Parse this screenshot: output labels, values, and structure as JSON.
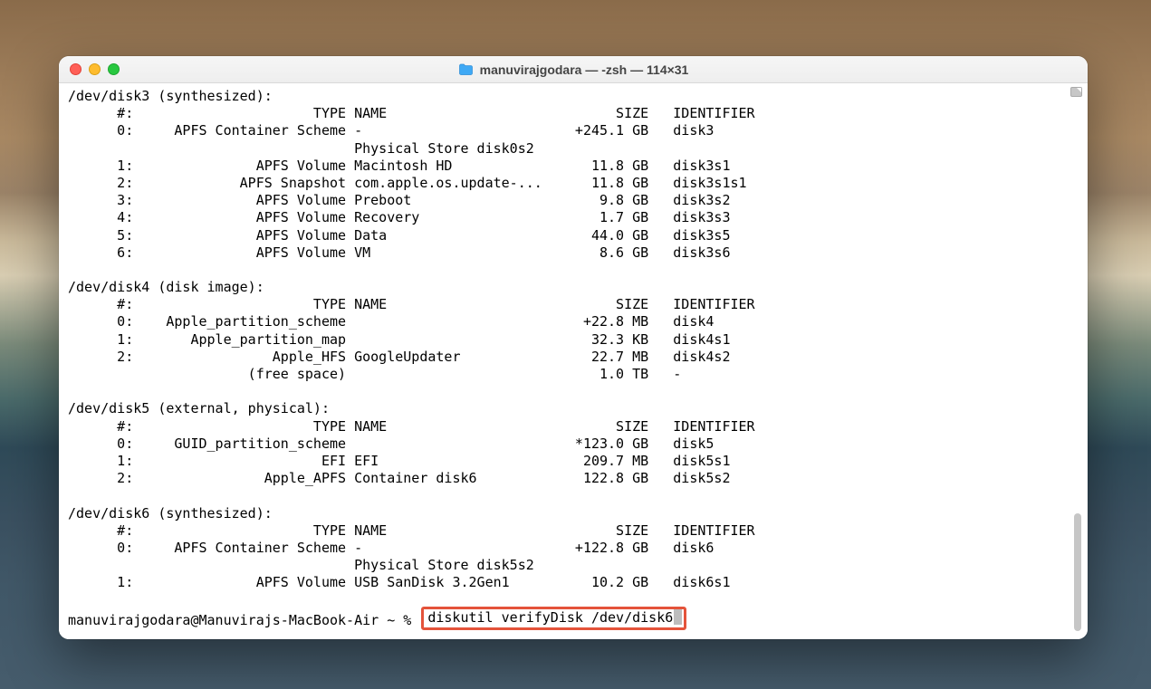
{
  "window": {
    "title": "manuvirajgodara — -zsh — 114×31"
  },
  "terminal": {
    "columns": {
      "num": 5,
      "type": 26,
      "name": 26,
      "size": 10,
      "id": 12
    },
    "sections": [
      {
        "header": "/dev/disk3 (synthesized):",
        "rows": [
          {
            "num": "#:",
            "type": "TYPE",
            "name": "NAME",
            "size": "SIZE",
            "id": "IDENTIFIER"
          },
          {
            "num": "0:",
            "type": "APFS Container Scheme",
            "name": "-",
            "size": "+245.1 GB",
            "id": "disk3"
          },
          {
            "num": "",
            "type": "",
            "name": "Physical Store disk0s2",
            "size": "",
            "id": ""
          },
          {
            "num": "1:",
            "type": "APFS Volume",
            "name": "Macintosh HD",
            "size": "11.8 GB",
            "id": "disk3s1"
          },
          {
            "num": "2:",
            "type": "APFS Snapshot",
            "name": "com.apple.os.update-...",
            "size": "11.8 GB",
            "id": "disk3s1s1"
          },
          {
            "num": "3:",
            "type": "APFS Volume",
            "name": "Preboot",
            "size": "9.8 GB",
            "id": "disk3s2"
          },
          {
            "num": "4:",
            "type": "APFS Volume",
            "name": "Recovery",
            "size": "1.7 GB",
            "id": "disk3s3"
          },
          {
            "num": "5:",
            "type": "APFS Volume",
            "name": "Data",
            "size": "44.0 GB",
            "id": "disk3s5"
          },
          {
            "num": "6:",
            "type": "APFS Volume",
            "name": "VM",
            "size": "8.6 GB",
            "id": "disk3s6"
          }
        ]
      },
      {
        "header": "/dev/disk4 (disk image):",
        "rows": [
          {
            "num": "#:",
            "type": "TYPE",
            "name": "NAME",
            "size": "SIZE",
            "id": "IDENTIFIER"
          },
          {
            "num": "0:",
            "type": "Apple_partition_scheme",
            "name": "",
            "size": "+22.8 MB",
            "id": "disk4"
          },
          {
            "num": "1:",
            "type": "Apple_partition_map",
            "name": "",
            "size": "32.3 KB",
            "id": "disk4s1"
          },
          {
            "num": "2:",
            "type": "Apple_HFS",
            "name": "GoogleUpdater",
            "size": "22.7 MB",
            "id": "disk4s2"
          },
          {
            "num": "",
            "type": "(free space)",
            "name": "",
            "size": "1.0 TB",
            "id": "-"
          }
        ]
      },
      {
        "header": "/dev/disk5 (external, physical):",
        "rows": [
          {
            "num": "#:",
            "type": "TYPE",
            "name": "NAME",
            "size": "SIZE",
            "id": "IDENTIFIER"
          },
          {
            "num": "0:",
            "type": "GUID_partition_scheme",
            "name": "",
            "size": "*123.0 GB",
            "id": "disk5"
          },
          {
            "num": "1:",
            "type": "EFI",
            "name": "EFI",
            "size": "209.7 MB",
            "id": "disk5s1"
          },
          {
            "num": "2:",
            "type": "Apple_APFS",
            "name": "Container disk6",
            "size": "122.8 GB",
            "id": "disk5s2"
          }
        ]
      },
      {
        "header": "/dev/disk6 (synthesized):",
        "rows": [
          {
            "num": "#:",
            "type": "TYPE",
            "name": "NAME",
            "size": "SIZE",
            "id": "IDENTIFIER"
          },
          {
            "num": "0:",
            "type": "APFS Container Scheme",
            "name": "-",
            "size": "+122.8 GB",
            "id": "disk6"
          },
          {
            "num": "",
            "type": "",
            "name": "Physical Store disk5s2",
            "size": "",
            "id": ""
          },
          {
            "num": "1:",
            "type": "APFS Volume",
            "name": "USB SanDisk 3.2Gen1",
            "size": "10.2 GB",
            "id": "disk6s1"
          }
        ]
      }
    ],
    "prompt": "manuvirajgodara@Manuvirajs-MacBook-Air ~ % ",
    "command": "diskutil verifyDisk /dev/disk6"
  }
}
